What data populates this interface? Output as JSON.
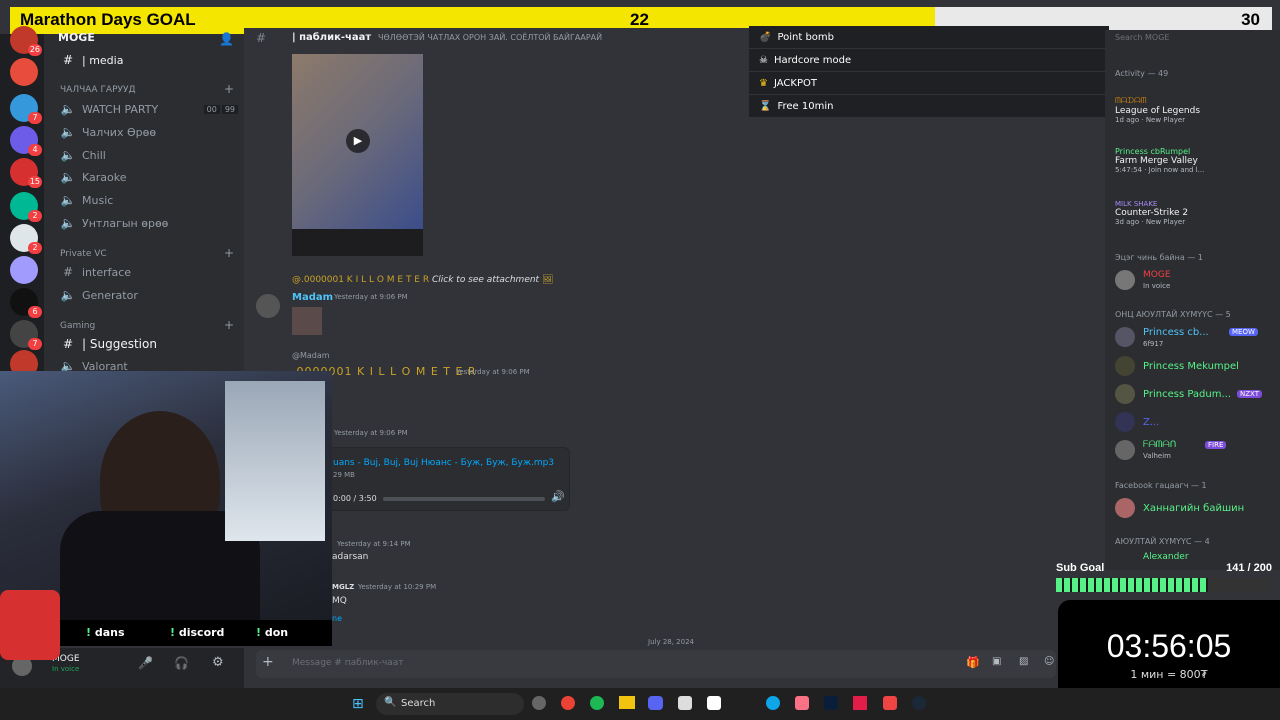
{
  "goal": {
    "title": "Marathon Days GOAL",
    "current": "22",
    "target": "30",
    "progress": 0.733
  },
  "server": {
    "name": "MOGE"
  },
  "rail_badges": [
    "26",
    "7",
    "4",
    "15",
    "1",
    "2",
    "2",
    "6",
    "7",
    "6",
    "6",
    "1"
  ],
  "sidebar": {
    "channels": [
      {
        "icon": "hash-icon",
        "label": "| media"
      },
      {
        "category": "ЧАЛЧАА ГАРУУД"
      },
      {
        "icon": "speaker-icon",
        "label": "WATCH PARTY",
        "count_a": "00",
        "count_b": "99"
      },
      {
        "icon": "speaker-icon",
        "label": "Чалчих Өрөө"
      },
      {
        "icon": "speaker-icon",
        "label": "Chill"
      },
      {
        "icon": "speaker-icon",
        "label": "Karaoke"
      },
      {
        "icon": "speaker-icon",
        "label": "Music"
      },
      {
        "icon": "speaker-icon",
        "label": "Унтлагын өрөө"
      },
      {
        "category": "Private VC"
      },
      {
        "icon": "hash-icon",
        "label": "interface"
      },
      {
        "icon": "speaker-icon",
        "label": "Generator"
      },
      {
        "category": "Gaming"
      },
      {
        "icon": "hash-icon",
        "label": "| Suggestion"
      },
      {
        "icon": "speaker-icon",
        "label": "Valorant"
      }
    ]
  },
  "chat": {
    "channel": "| паблик-чаат",
    "topic": "ЧӨЛӨӨТЭЙ ЧАТЛАХ ОРОН ЗАЙ. СОЁЛТОЙ БАЙГААРАЙ",
    "reply1": {
      "user": "@.0000001 K I L L O M E T E R",
      "note": "Click to see attachment"
    },
    "msg1": {
      "author": "Madam",
      "time": "Yesterday at 9:06 PM"
    },
    "reply2": {
      "user": "@Madam"
    },
    "msg2": {
      "author": ".0000001 K I L L O M E T E R",
      "time": "Yesterday at 9:06 PM"
    },
    "msg3": {
      "time": "Yesterday at 9:06 PM"
    },
    "audio": {
      "file": "uans - Buj, Buj, Buj Нюанс - Буж, Буж, Буж.mp3",
      "size": "29 MB",
      "time": "0:00 / 3:50"
    },
    "msg4": {
      "time": "Yesterday at 9:14 PM",
      "text": "adarsan"
    },
    "msg5": {
      "author": "MGLZ",
      "time": "Yesterday at 10:29 PM",
      "text": "MQ",
      "text2": "ne"
    },
    "date_divider": "July 28, 2024",
    "composer_placeholder": "Message #  паблик-чаат"
  },
  "overlay_list": [
    {
      "icon": "bomb-icon",
      "label": "Point bomb"
    },
    {
      "icon": "skull-icon",
      "label": "Hardcore mode"
    },
    {
      "icon": "crown-icon",
      "label": "JACKPOT"
    },
    {
      "icon": "hourglass-icon",
      "label": "Free 10min"
    }
  ],
  "members": {
    "search": "Search MOGE",
    "activity": "Activity — 49",
    "items": [
      {
        "name": "ᗰᗩᗪᗩᗰ",
        "game": "League of Legends",
        "sub": "1d ago · New Player"
      },
      {
        "name": "Princess cbRumpel",
        "game": "Farm Merge Valley",
        "sub": "5:47:54 · Join now and l..."
      },
      {
        "name": "MILK SHAKE",
        "game": "Counter-Strike 2",
        "sub": "3d ago · New Player"
      }
    ],
    "groups": [
      {
        "header": "Эцэг чинь байна — 1",
        "rows": [
          {
            "name": "MOGE",
            "sub": "In voice",
            "color": "#f23f42"
          }
        ]
      },
      {
        "header": "ОНЦ АЮУЛТАЙ ХҮМҮҮС — 5",
        "rows": [
          {
            "name": "Princess cb...",
            "tag": "MEOW",
            "sub": "6f917",
            "color": "#4fc3f7"
          },
          {
            "name": "Princess Mekumpel",
            "color": "#57f287"
          },
          {
            "name": "Princess Padum...",
            "tag": "NZXT",
            "color": "#57f287"
          },
          {
            "name": "Z...",
            "color": "#5865f2"
          },
          {
            "name": "ᖴᗩᗰᗩᑎ",
            "tag": "FIRE",
            "sub": "Valheim",
            "color": "#57f287"
          }
        ]
      },
      {
        "header": "Facebook гацаагч — 1",
        "rows": [
          {
            "name": "Ханнагийн байшин",
            "color": "#57f287"
          }
        ]
      },
      {
        "header": "АЮУЛТАЙ ХҮМҮҮС — 4",
        "rows": [
          {
            "name": "Alexander",
            "color": "#57f287"
          }
        ]
      }
    ]
  },
  "subgoal": {
    "label": "Sub Goal",
    "value": "141 / 200",
    "progress": 0.705
  },
  "timer": {
    "time": "03:56:05",
    "rate": "1 мин = 800₮"
  },
  "commands": [
    "dans",
    "discord",
    "don"
  ],
  "userbar": {
    "name": "MOGE",
    "status": "In voice"
  },
  "taskbar": {
    "search": "Search"
  },
  "colors": {
    "accent": "#f5e600",
    "discord_bg": "#313338",
    "green": "#57f287",
    "red": "#f23f42"
  }
}
